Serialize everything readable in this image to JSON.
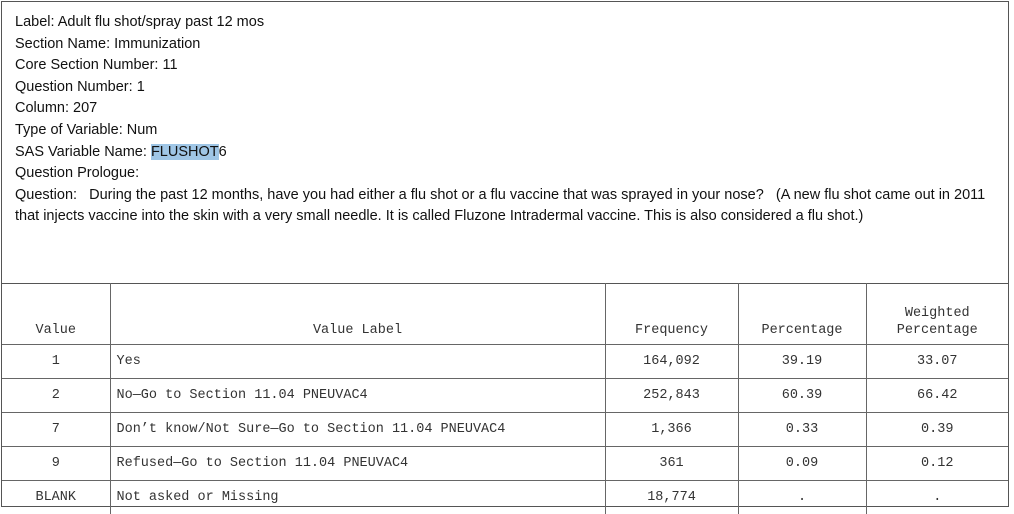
{
  "header": {
    "label": "Label: Adult flu shot/spray past 12 mos",
    "section_name": "Section Name: Immunization",
    "core_section_number": "Core Section Number: 11",
    "question_number": "Question Number: 1",
    "column": "Column: 207",
    "type_of_variable": "Type of Variable: Num",
    "sas_variable_prefix": "SAS Variable Name: ",
    "sas_variable_highlight": "FLUSHOT",
    "sas_variable_suffix": "6",
    "question_prologue": "Question Prologue:",
    "question": "Question:   During the past 12 months, have you had either a flu shot or a flu vaccine that was sprayed in your nose?   (A new flu shot came out in 2011 that injects vaccine into the skin with a very small needle. It is called Fluzone Intradermal vaccine. This is also considered a flu shot.)"
  },
  "table": {
    "headers": {
      "value": "Value",
      "value_label": "Value Label",
      "frequency": "Frequency",
      "percentage": "Percentage",
      "weighted_line1": "Weighted",
      "weighted_line2": "Percentage"
    },
    "rows": [
      {
        "value": "1",
        "label": "Yes",
        "frequency": "164,092",
        "percentage": "39.19",
        "weighted": "33.07"
      },
      {
        "value": "2",
        "label": "No—Go to Section 11.04 PNEUVAC4",
        "frequency": "252,843",
        "percentage": "60.39",
        "weighted": "66.42"
      },
      {
        "value": "7",
        "label": "Don’t know/Not Sure—Go to Section 11.04 PNEUVAC4",
        "frequency": "1,366",
        "percentage": "0.33",
        "weighted": "0.39"
      },
      {
        "value": "9",
        "label": "Refused—Go to Section 11.04 PNEUVAC4",
        "frequency": "361",
        "percentage": "0.09",
        "weighted": "0.12"
      },
      {
        "value": "BLANK",
        "label": "Not asked or Missing",
        "frequency": "18,774",
        "percentage": ".",
        "weighted": "."
      }
    ]
  }
}
